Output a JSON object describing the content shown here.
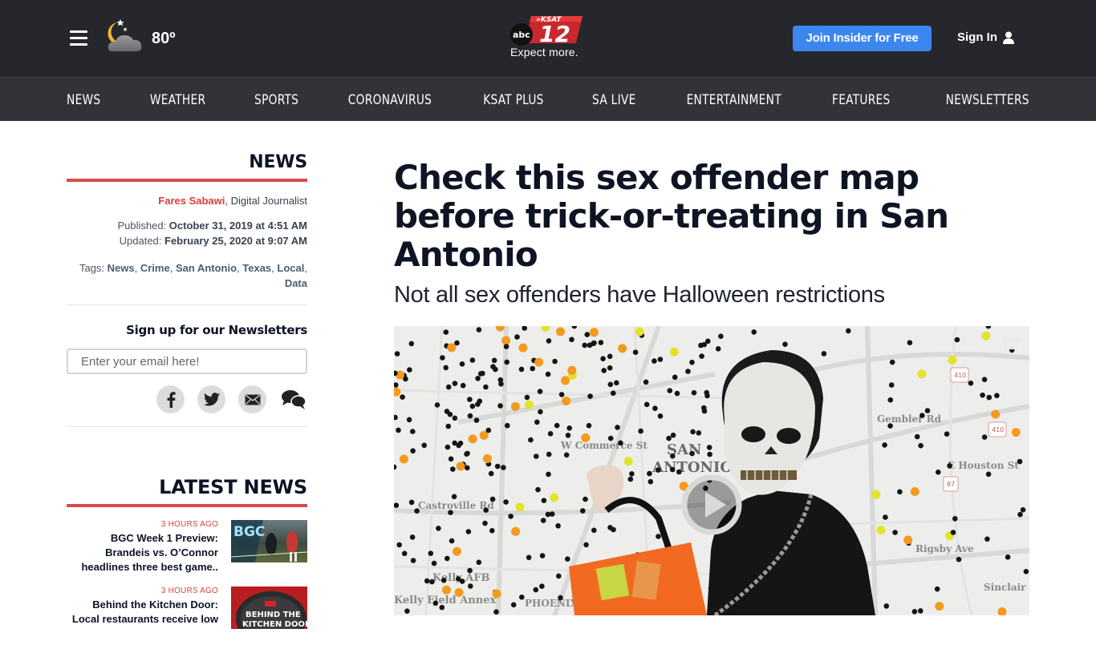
{
  "header": {
    "menu_icon": "hamburger-icon",
    "weather": {
      "icon": "night-cloudy-icon",
      "temperature": "80º"
    },
    "logo": {
      "network": "abc",
      "brand": "KSAT",
      "channel": "12",
      "tagline": "Expect more."
    },
    "join_button": "Join Insider for Free",
    "sign_in": "Sign In",
    "sign_in_icon": "user-icon"
  },
  "nav": {
    "items": [
      "NEWS",
      "WEATHER",
      "SPORTS",
      "CORONAVIRUS",
      "KSAT PLUS",
      "SA LIVE",
      "ENTERTAINMENT",
      "FEATURES",
      "NEWSLETTERS"
    ]
  },
  "sidebar": {
    "section": "NEWS",
    "author": "Fares Sabawi",
    "author_role": ", Digital Journalist",
    "published_label": "Published: ",
    "published": "October 31, 2019 at 4:51 AM",
    "updated_label": "Updated: ",
    "updated": "February 25, 2020 at 9:07 AM",
    "tags_label": "Tags: ",
    "tags": [
      "News",
      "Crime",
      "San Antonio",
      "Texas",
      "Local",
      "Data"
    ],
    "newsletter_title": "Sign up for our Newsletters",
    "email_placeholder": "Enter your email here!",
    "share": [
      "facebook-icon",
      "twitter-icon",
      "email-icon",
      "comments-icon"
    ]
  },
  "latest": {
    "title": "LATEST NEWS",
    "items": [
      {
        "ago": "3 HOURS AGO",
        "headline": "BGC Week 1 Preview: Brandeis vs. O’Connor headlines three best game..",
        "thumb_text": "BGC"
      },
      {
        "ago": "3 HOURS AGO",
        "headline": "Behind the Kitchen Door: Local restaurants receive low",
        "thumb_text": "BEHIND THE KITCHEN DOOR"
      }
    ]
  },
  "article": {
    "headline": "Check this sex offender map before trick-or-treating in San Antonio",
    "subhead": "Not all sex offenders have Halloween restrictions",
    "hero": {
      "map_labels": [
        "SAN",
        "ANTONIO",
        "W Commerce St",
        "Castroville Rd",
        "Kelly AFB",
        "Kelly Field Annex",
        "PHOENIX",
        "Gembler Rd",
        "E Houston St",
        "Rigsby Ave",
        "Sinclair Rd",
        "410",
        "410",
        "87"
      ],
      "play_icon": "play-icon",
      "share_icon": "share-icon"
    }
  },
  "colors": {
    "topbar": "#25272c",
    "nav": "#313338",
    "accent_red": "#db4a4a",
    "join_blue": "#3c86f0",
    "headline": "#0e1424",
    "tag_link": "#4a5c77"
  }
}
